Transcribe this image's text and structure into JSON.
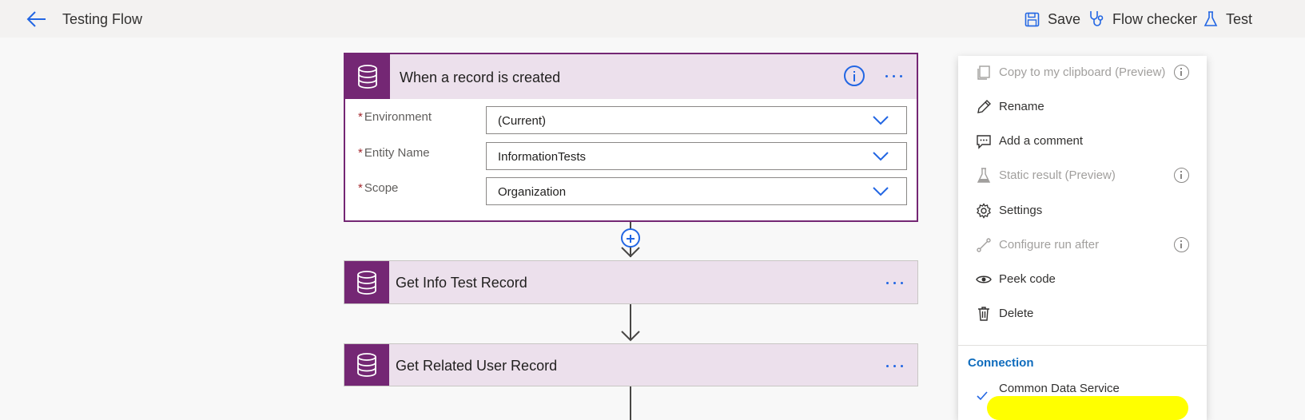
{
  "header": {
    "title": "Testing Flow",
    "save_label": "Save",
    "flow_checker_label": "Flow checker",
    "test_label": "Test"
  },
  "colors": {
    "connector_purple": "#742774",
    "card_bg": "#ece0ec",
    "accent_blue": "#2266e3",
    "highlight_yellow": "#ffff00"
  },
  "trigger": {
    "title": "When a record is created",
    "fields": [
      {
        "label": "Environment",
        "value": "(Current)",
        "required": true
      },
      {
        "label": "Entity Name",
        "value": "InformationTests",
        "required": true
      },
      {
        "label": "Scope",
        "value": "Organization",
        "required": true
      }
    ]
  },
  "steps": [
    {
      "title": "Get Info Test Record"
    },
    {
      "title": "Get Related User Record"
    }
  ],
  "menu": {
    "items": [
      {
        "label": "Copy to my clipboard (Preview)",
        "icon": "copy-icon",
        "disabled": true,
        "info": true
      },
      {
        "label": "Rename",
        "icon": "pencil-icon",
        "disabled": false,
        "info": false
      },
      {
        "label": "Add a comment",
        "icon": "comment-icon",
        "disabled": false,
        "info": false
      },
      {
        "label": "Static result (Preview)",
        "icon": "beaker-icon",
        "disabled": true,
        "info": true
      },
      {
        "label": "Settings",
        "icon": "gear-icon",
        "disabled": false,
        "info": false
      },
      {
        "label": "Configure run after",
        "icon": "run-after-icon",
        "disabled": true,
        "info": true
      },
      {
        "label": "Peek code",
        "icon": "eye-icon",
        "disabled": false,
        "info": false
      },
      {
        "label": "Delete",
        "icon": "trash-icon",
        "disabled": false,
        "info": false
      }
    ],
    "connection_heading": "Connection",
    "connection_name": "Common Data Service"
  }
}
